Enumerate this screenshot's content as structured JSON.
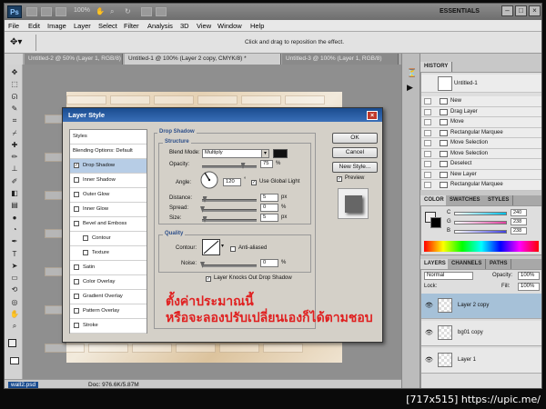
{
  "titlebar": {
    "app_logo": "Ps",
    "zoom": "100%",
    "workspace": "ESSENTIALS",
    "minimize": "–",
    "maximize": "□",
    "close": "×"
  },
  "menu": [
    "File",
    "Edit",
    "Image",
    "Layer",
    "Select",
    "Filter",
    "Analysis",
    "3D",
    "View",
    "Window",
    "Help"
  ],
  "options_bar": {
    "hint": "Click and drag to reposition the effect."
  },
  "doc_tabs": [
    {
      "label": "Untitled-2 @ 50% (Layer 1, RGB/8) *",
      "active": false
    },
    {
      "label": "Untitled-1 @ 100% (Layer 2 copy, CMYK/8) *",
      "active": true
    },
    {
      "label": "Untitled-3 @ 100% (Layer 1, RGB/8)",
      "active": false
    }
  ],
  "status": {
    "filename": "wall2.psd",
    "doc_size": "Doc: 976.6K/5.87M"
  },
  "history": {
    "tab": "HISTORY",
    "snapshot": "Untitled-1",
    "items": [
      "New",
      "Drag Layer",
      "Move",
      "Rectangular Marquee",
      "Move Selection",
      "Move Selection",
      "Deselect",
      "New Layer",
      "Rectangular Marquee"
    ]
  },
  "color_panel": {
    "tabs": [
      "COLOR",
      "SWATCHES",
      "STYLES"
    ],
    "channels": [
      {
        "name": "C",
        "value": "240",
        "color": "#00bfe6"
      },
      {
        "name": "G",
        "value": "238",
        "color": "#e040a0"
      },
      {
        "name": "B",
        "value": "238",
        "color": "#4040e0"
      }
    ]
  },
  "layers_panel": {
    "tabs": [
      "LAYERS",
      "CHANNELS",
      "PATHS"
    ],
    "blend": "Normal",
    "opacity_label": "Opacity:",
    "opacity": "100%",
    "lock_label": "Lock:",
    "fill_label": "Fill:",
    "fill": "100%",
    "layers": [
      {
        "name": "Layer 2 copy",
        "selected": true
      },
      {
        "name": "bg01 copy",
        "selected": false
      },
      {
        "name": "Layer 1",
        "selected": false
      }
    ]
  },
  "dialog": {
    "title": "Layer Style",
    "close": "×",
    "styles": [
      {
        "label": "Styles",
        "type": "header"
      },
      {
        "label": "Blending Options: Default",
        "type": "header"
      },
      {
        "label": "Drop Shadow",
        "checked": true,
        "selected": true
      },
      {
        "label": "Inner Shadow",
        "checked": false
      },
      {
        "label": "Outer Glow",
        "checked": false
      },
      {
        "label": "Inner Glow",
        "checked": false
      },
      {
        "label": "Bevel and Emboss",
        "checked": false
      },
      {
        "label": "Contour",
        "checked": false,
        "sub": true
      },
      {
        "label": "Texture",
        "checked": false,
        "sub": true
      },
      {
        "label": "Satin",
        "checked": false
      },
      {
        "label": "Color Overlay",
        "checked": false
      },
      {
        "label": "Gradient Overlay",
        "checked": false
      },
      {
        "label": "Pattern Overlay",
        "checked": false
      },
      {
        "label": "Stroke",
        "checked": false
      }
    ],
    "drop_shadow": "Drop Shadow",
    "structure": "Structure",
    "blend_mode_label": "Blend Mode:",
    "blend_mode": "Multiply",
    "opacity_label": "Opacity:",
    "opacity": "75",
    "opacity_level": 0.75,
    "angle_label": "Angle:",
    "angle": "120",
    "degree": "°",
    "global_light": "Use Global Light",
    "distance_label": "Distance:",
    "distance": "5",
    "distance_level": 0.05,
    "spread_label": "Spread:",
    "spread": "0",
    "size_label": "Size:",
    "size": "5",
    "size_level": 0.05,
    "unit_px": "px",
    "unit_pct": "%",
    "quality": "Quality",
    "contour_label": "Contour:",
    "anti_aliased": "Anti-aliased",
    "noise_label": "Noise:",
    "noise": "0",
    "knockout": "Layer Knocks Out Drop Shadow",
    "buttons": {
      "ok": "OK",
      "cancel": "Cancel",
      "new_style": "New Style..."
    },
    "preview": "Preview"
  },
  "annotation": {
    "line1": "ตั้งค่าประมาณนี้",
    "line2": "หรือจะลองปรับเปลี่ยนเองก็ได้ตามชอบ",
    "color": "#e02020"
  },
  "watermark": "[717x515] https://upic.me/"
}
